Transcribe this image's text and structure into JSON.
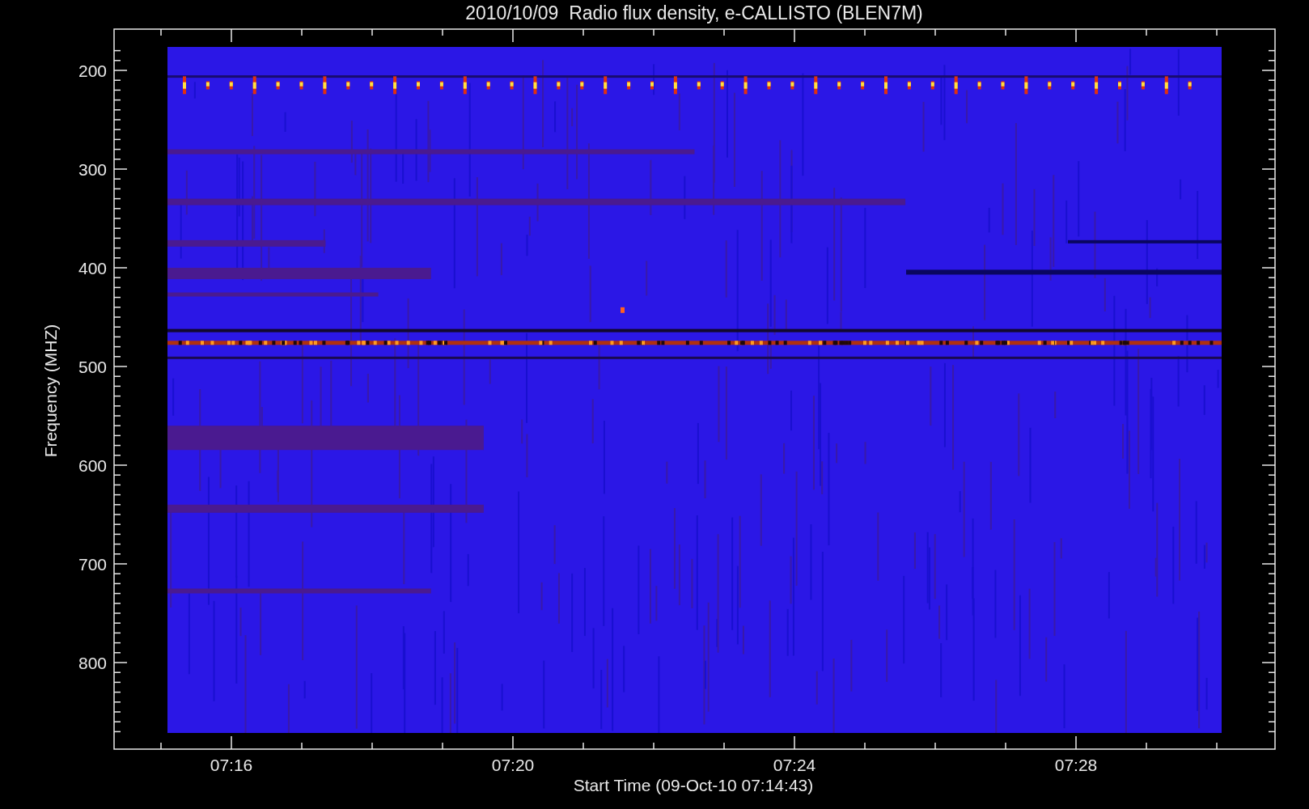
{
  "plot": {
    "title": "2010/10/09  Radio flux density, e-CALLISTO (BLEN7M)",
    "y_axis": {
      "label": "Frequency (MHZ)",
      "ticks": [
        "200",
        "300",
        "400",
        "500",
        "600",
        "700",
        "800"
      ]
    },
    "x_axis": {
      "label": "Start Time (09-Oct-10 07:14:43)",
      "ticks": [
        "07:16",
        "07:20",
        "07:24",
        "07:28"
      ]
    }
  }
}
